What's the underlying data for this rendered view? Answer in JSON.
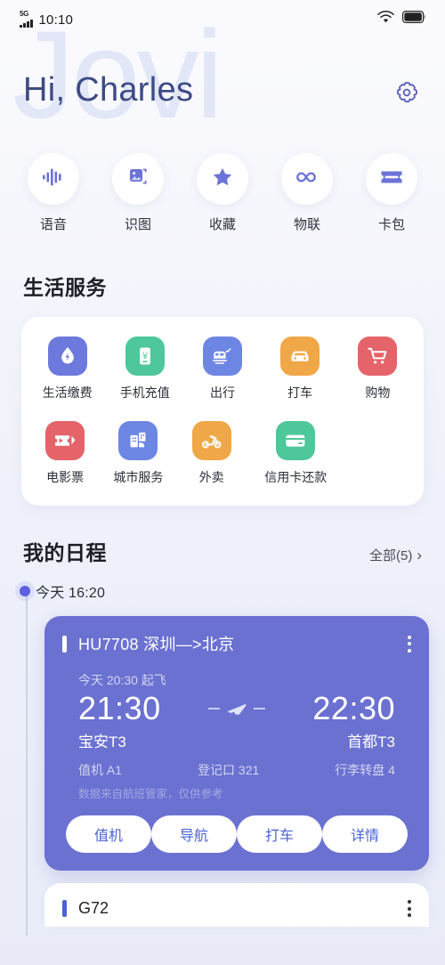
{
  "statusbar": {
    "network": "5G",
    "time": "10:10",
    "wifi_icon": "wifi-icon",
    "battery_icon": "battery-icon"
  },
  "header": {
    "watermark": "Jovi",
    "greeting": "Hi, Charles",
    "settings_icon": "gear-icon"
  },
  "quick_actions": [
    {
      "label": "语音",
      "icon": "voice-waveform-icon"
    },
    {
      "label": "识图",
      "icon": "image-recognition-icon"
    },
    {
      "label": "收藏",
      "icon": "star-icon"
    },
    {
      "label": "物联",
      "icon": "infinity-icon"
    },
    {
      "label": "卡包",
      "icon": "ticket-card-icon"
    }
  ],
  "life_services": {
    "title": "生活服务",
    "row1": [
      {
        "label": "生活缴费",
        "icon": "water-drop-bolt-icon",
        "color": "#6e79dd"
      },
      {
        "label": "手机充值",
        "icon": "phone-yuan-icon",
        "color": "#4ec79a"
      },
      {
        "label": "出行",
        "icon": "train-plane-icon",
        "color": "#6e86e3"
      },
      {
        "label": "打车",
        "icon": "car-icon",
        "color": "#f0a747"
      },
      {
        "label": "购物",
        "icon": "shopping-cart-icon",
        "color": "#e4646a"
      }
    ],
    "row2": [
      {
        "label": "电影票",
        "icon": "movie-ticket-icon",
        "color": "#e4646a"
      },
      {
        "label": "城市服务",
        "icon": "city-buildings-icon",
        "color": "#6e86e3"
      },
      {
        "label": "外卖",
        "icon": "scooter-icon",
        "color": "#f0a747"
      },
      {
        "label": "信用卡还款",
        "icon": "credit-card-icon",
        "color": "#4ec79a"
      }
    ]
  },
  "schedule": {
    "title": "我的日程",
    "all_label": "全部(5)",
    "chevron_icon": "chevron-right-icon",
    "timeline_time": "今天 16:20",
    "flight": {
      "title": "HU7708 深圳—>北京",
      "menu_icon": "more-vertical-icon",
      "depart_note": "今天 20:30 起飞",
      "time_from": "21:30",
      "time_to": "22:30",
      "plane_icon": "airplane-icon",
      "port_from": "宝安T3",
      "port_to": "首都T3",
      "checkin": "值机 A1",
      "gate": "登记口 321",
      "baggage": "行李转盘 4",
      "disclaimer": "数据来自航班管家，仅供参考",
      "buttons": [
        "值机",
        "导航",
        "打车",
        "详情"
      ]
    },
    "train": {
      "title": "G72",
      "menu_icon": "more-vertical-icon"
    }
  }
}
